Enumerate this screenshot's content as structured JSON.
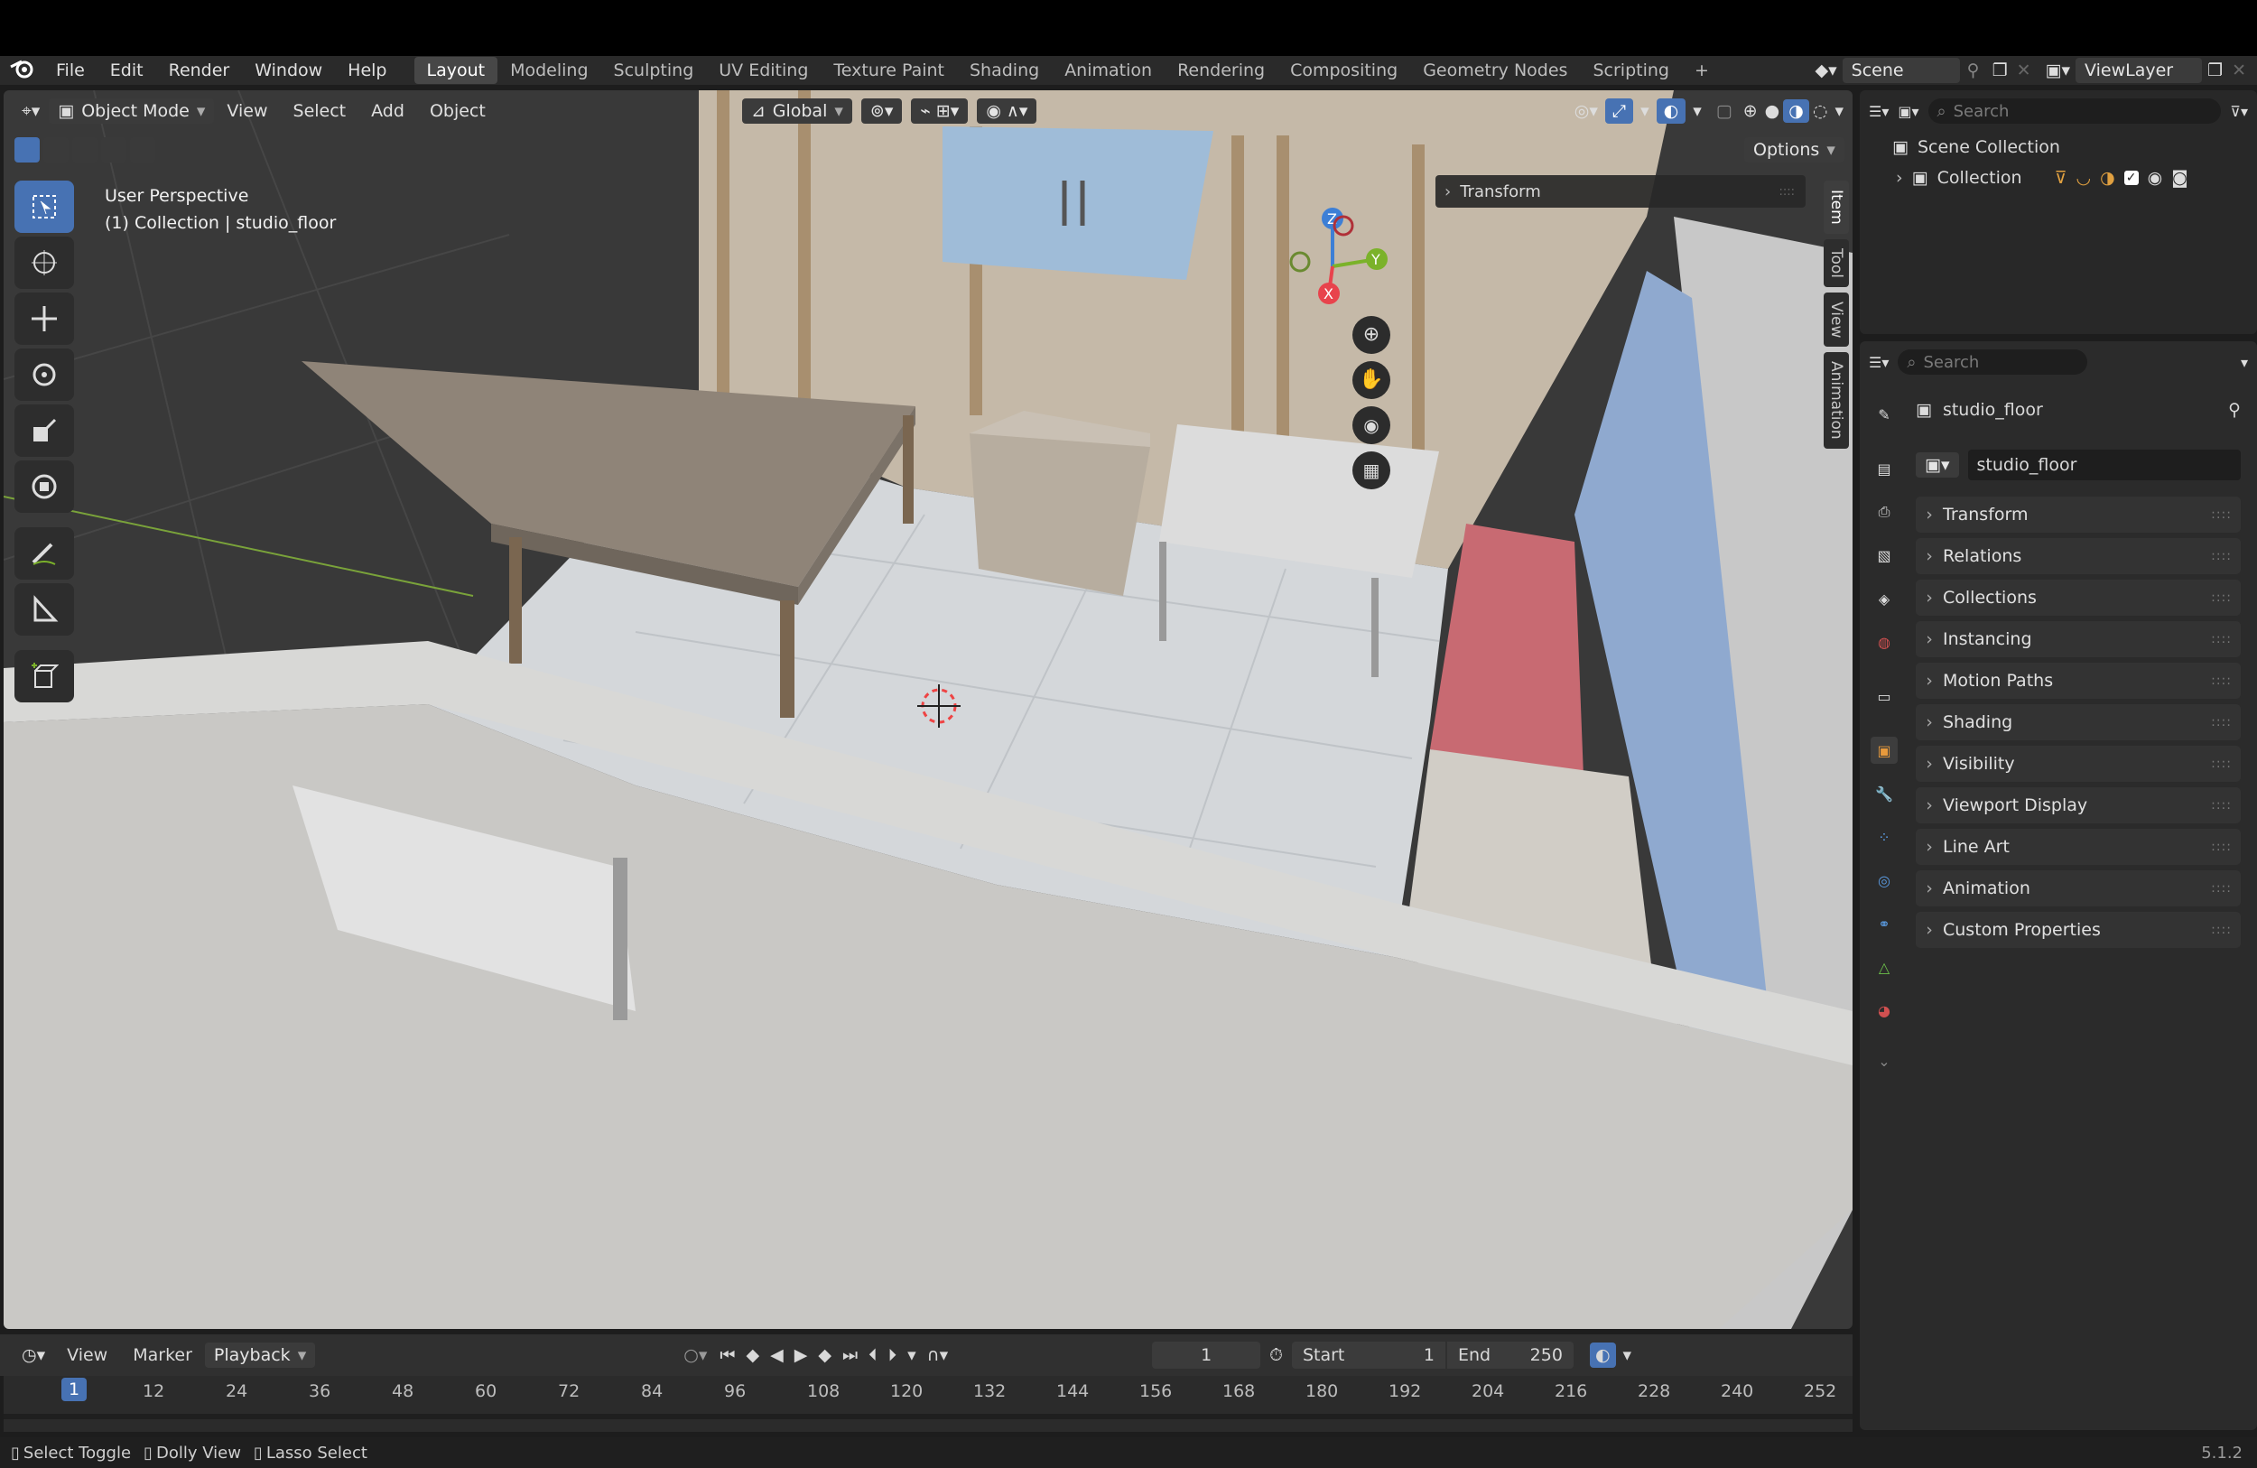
{
  "menu": {
    "items": [
      "File",
      "Edit",
      "Render",
      "Window",
      "Help"
    ],
    "workspaces": [
      "Layout",
      "Modeling",
      "Sculpting",
      "UV Editing",
      "Texture Paint",
      "Shading",
      "Animation",
      "Rendering",
      "Compositing",
      "Geometry Nodes",
      "Scripting"
    ],
    "active_workspace": "Layout",
    "scene_label": "Scene",
    "view_layer_label": "ViewLayer"
  },
  "viewport_header": {
    "mode": "Object Mode",
    "menus": [
      "View",
      "Select",
      "Add",
      "Object"
    ],
    "orientation": "Global",
    "options_label": "Options"
  },
  "viewport": {
    "perspective_label": "User Perspective",
    "context_label": "(1) Collection | studio_floor",
    "transform_panel_label": "Transform",
    "gizmo_axes": {
      "z": "Z",
      "y": "Y",
      "x": "X"
    },
    "npanel_tabs": [
      "Item",
      "Tool",
      "View",
      "Animation"
    ]
  },
  "outliner": {
    "search_placeholder": "Search",
    "root": "Scene Collection",
    "collection": "Collection"
  },
  "properties": {
    "search_placeholder": "Search",
    "object_name": "studio_floor",
    "object_field": "studio_floor",
    "panels": [
      "Transform",
      "Relations",
      "Collections",
      "Instancing",
      "Motion Paths",
      "Shading",
      "Visibility",
      "Viewport Display",
      "Line Art",
      "Animation",
      "Custom Properties"
    ]
  },
  "timeline": {
    "menus": [
      "View",
      "Marker",
      "Playback"
    ],
    "current_frame": "1",
    "start_label": "Start",
    "start_value": "1",
    "end_label": "End",
    "end_value": "250",
    "ruler": [
      "1",
      "12",
      "24",
      "36",
      "48",
      "60",
      "72",
      "84",
      "96",
      "108",
      "120",
      "132",
      "144",
      "156",
      "168",
      "180",
      "192",
      "204",
      "216",
      "228",
      "240",
      "252"
    ]
  },
  "statusbar": {
    "items": [
      "Select Toggle",
      "Dolly View",
      "Lasso Select"
    ],
    "version": "5.1.2"
  },
  "colors": {
    "accent": "#4772b3",
    "axis_x": "#e8434c",
    "axis_y": "#7bb22a",
    "axis_z": "#3d7fd6"
  }
}
